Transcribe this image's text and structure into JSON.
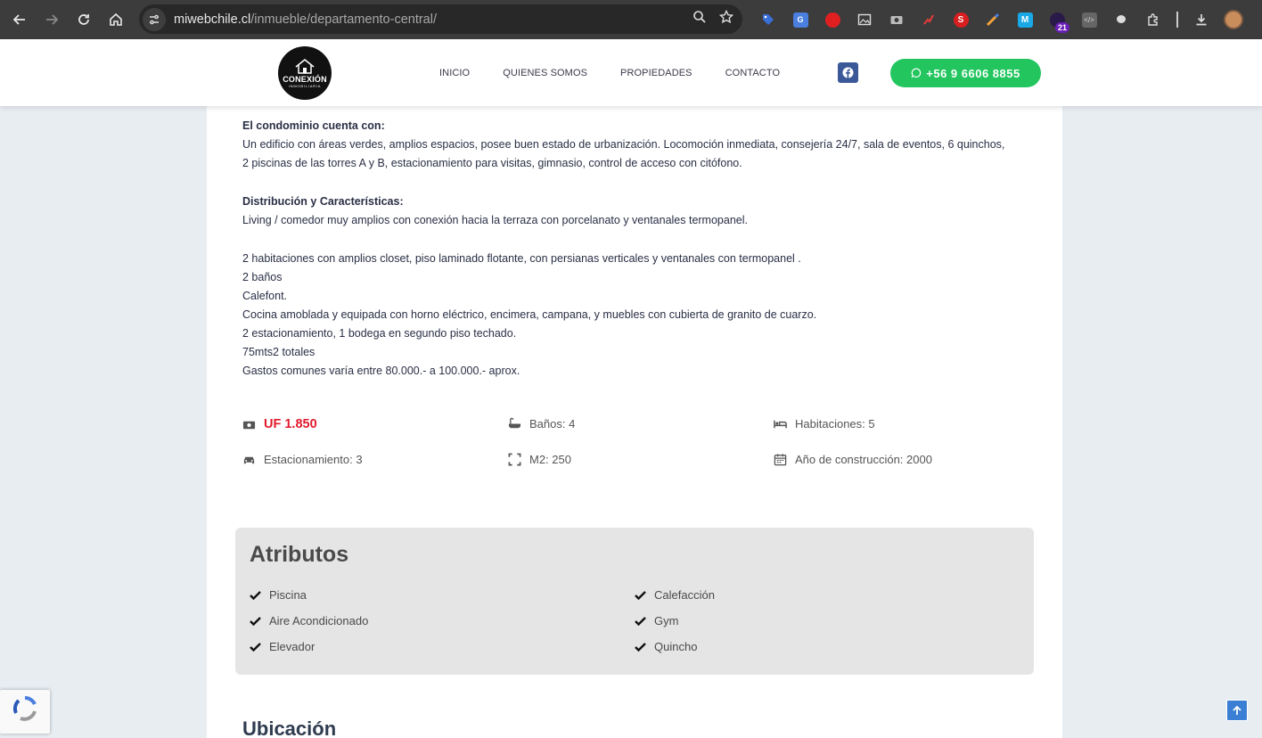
{
  "browser": {
    "url_domain": "miwebchile.cl",
    "url_path": "/inmueble/departamento-central/",
    "extension_badge": "21"
  },
  "header": {
    "logo_text": "CONEXIÓN",
    "logo_sub": "INMOBILIARIA",
    "menu": [
      "INICIO",
      "QUIENES SOMOS",
      "PROPIEDADES",
      "CONTACTO"
    ],
    "whatsapp_label": "+56 9 6606 8855"
  },
  "description": {
    "condominio_heading": "El condominio cuenta con:",
    "condominio_text": "Un edificio con áreas verdes, amplios espacios, posee buen estado de urbanización. Locomoción inmediata, consejería 24/7, sala de eventos, 6 quinchos, 2 piscinas de las torres A y B, estacionamiento para visitas, gimnasio, control de acceso con citófono.",
    "distribucion_heading": "Distribución y Características:",
    "living": "Living / comedor muy amplios con conexión hacia la terraza con porcelanato y ventanales termopanel.",
    "lines": [
      "2 habitaciones con amplios closet, piso laminado flotante, con persianas verticales y ventanales con termopanel .",
      "2 baños",
      "Calefont.",
      "Cocina amoblada y equipada con horno eléctrico, encimera, campana, y muebles con cubierta de granito de cuarzo.",
      "2 estacionamiento, 1 bodega en segundo piso techado.",
      "75mts2 totales",
      "Gastos comunes varía entre 80.000.- a 100.000.- aprox."
    ]
  },
  "specs": {
    "price": "UF 1.850",
    "banos": "Baños: 4",
    "habitaciones": "Habitaciones: 5",
    "estacionamiento": "Estacionamiento: 3",
    "m2": "M2: 250",
    "anio": "Año de construcción: 2000"
  },
  "attributes": {
    "title": "Atributos",
    "left": [
      "Piscina",
      "Aire Acondicionado",
      "Elevador"
    ],
    "right": [
      "Calefacción",
      "Gym",
      "Quincho"
    ]
  },
  "location_title": "Ubicación",
  "colors": {
    "whatsapp": "#22c55e",
    "price": "#e21b2c",
    "facebook": "#3b5998",
    "page_bg": "#e8edf2"
  }
}
